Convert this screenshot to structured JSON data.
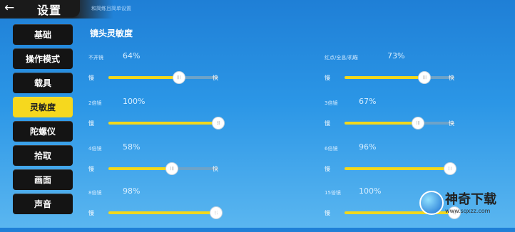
{
  "header": {
    "back_icon": "←",
    "title": "设置",
    "subtitle": "和简练且简单设置"
  },
  "sidebar": {
    "items": [
      {
        "label": "基础",
        "active": false
      },
      {
        "label": "操作模式",
        "active": false
      },
      {
        "label": "载具",
        "active": false
      },
      {
        "label": "灵敏度",
        "active": true
      },
      {
        "label": "陀螺仪",
        "active": false
      },
      {
        "label": "拾取",
        "active": false
      },
      {
        "label": "画面",
        "active": false
      },
      {
        "label": "声音",
        "active": false
      }
    ]
  },
  "section": {
    "title": "镜头灵敏度"
  },
  "sliders": [
    {
      "label": "不开镜",
      "value_text": "64%",
      "level": 0.64,
      "min_label": "慢",
      "max_label": "快"
    },
    {
      "label": "2倍镜",
      "value_text": "100%",
      "level": 1.0,
      "min_label": "慢",
      "max_label": "快"
    },
    {
      "label": "4倍镜",
      "value_text": "58%",
      "level": 0.58,
      "min_label": "慢",
      "max_label": "快"
    },
    {
      "label": "8倍镜",
      "value_text": "98%",
      "level": 0.98,
      "min_label": "慢",
      "max_label": "快"
    },
    {
      "label": "红点/全息/机瞄",
      "value_text": "73%",
      "level": 0.73,
      "min_label": "慢",
      "max_label": "快"
    },
    {
      "label": "3倍镜",
      "value_text": "67%",
      "level": 0.67,
      "min_label": "慢",
      "max_label": "快"
    },
    {
      "label": "6倍镜",
      "value_text": "96%",
      "level": 0.96,
      "min_label": "慢",
      "max_label": "快"
    },
    {
      "label": "15倍镜",
      "value_text": "100%",
      "level": 1.0,
      "min_label": "慢",
      "max_label": "快"
    }
  ],
  "watermark": {
    "name": "神奇下载",
    "url": "www.sqxzz.com"
  },
  "colors": {
    "accent": "#f6d81e",
    "sidebar_bg": "#141414"
  }
}
